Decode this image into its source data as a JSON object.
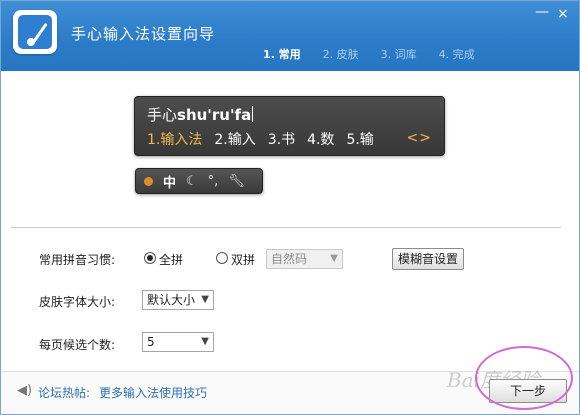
{
  "window": {
    "title": "手心输入法设置向导",
    "minimize_glyph": "—",
    "close_glyph": "×"
  },
  "steps": [
    {
      "label": "1. 常用",
      "active": true
    },
    {
      "label": "2. 皮肤",
      "active": false
    },
    {
      "label": "3. 词库",
      "active": false
    },
    {
      "label": "4. 完成",
      "active": false
    }
  ],
  "preview": {
    "composition_prefix": "手心",
    "composition_pinyin": "shu'ru'fa",
    "candidates": [
      "1.输入法",
      "2.输入",
      "3.书",
      "4.数",
      "5.输"
    ],
    "page_arrows": "<>",
    "status_bar": {
      "mode_text": "中",
      "icons": [
        "dot-icon",
        "moon-icon",
        "punctuation-icon",
        "wrench-icon"
      ]
    }
  },
  "form": {
    "pinyin_habit": {
      "label": "常用拼音习惯:",
      "options": [
        {
          "label": "全拼",
          "checked": true
        },
        {
          "label": "双拼",
          "checked": false
        }
      ],
      "shuangpin_scheme": "自然码",
      "fuzzy_button": "模糊音设置"
    },
    "font_size": {
      "label": "皮肤字体大小:",
      "value": "默认大小"
    },
    "candidates_per_page": {
      "label": "每页候选个数:",
      "value": "5"
    }
  },
  "footer": {
    "forum_label": "论坛热帖:",
    "forum_link": "更多输入法使用技巧",
    "next_button": "下一步"
  },
  "watermark": "Bai度经验",
  "colors": {
    "header": "#2b7bc8",
    "candidate_highlight": "#f2b84b",
    "link": "#2f6fb5",
    "annotation_ellipse": "#d26ad2"
  }
}
